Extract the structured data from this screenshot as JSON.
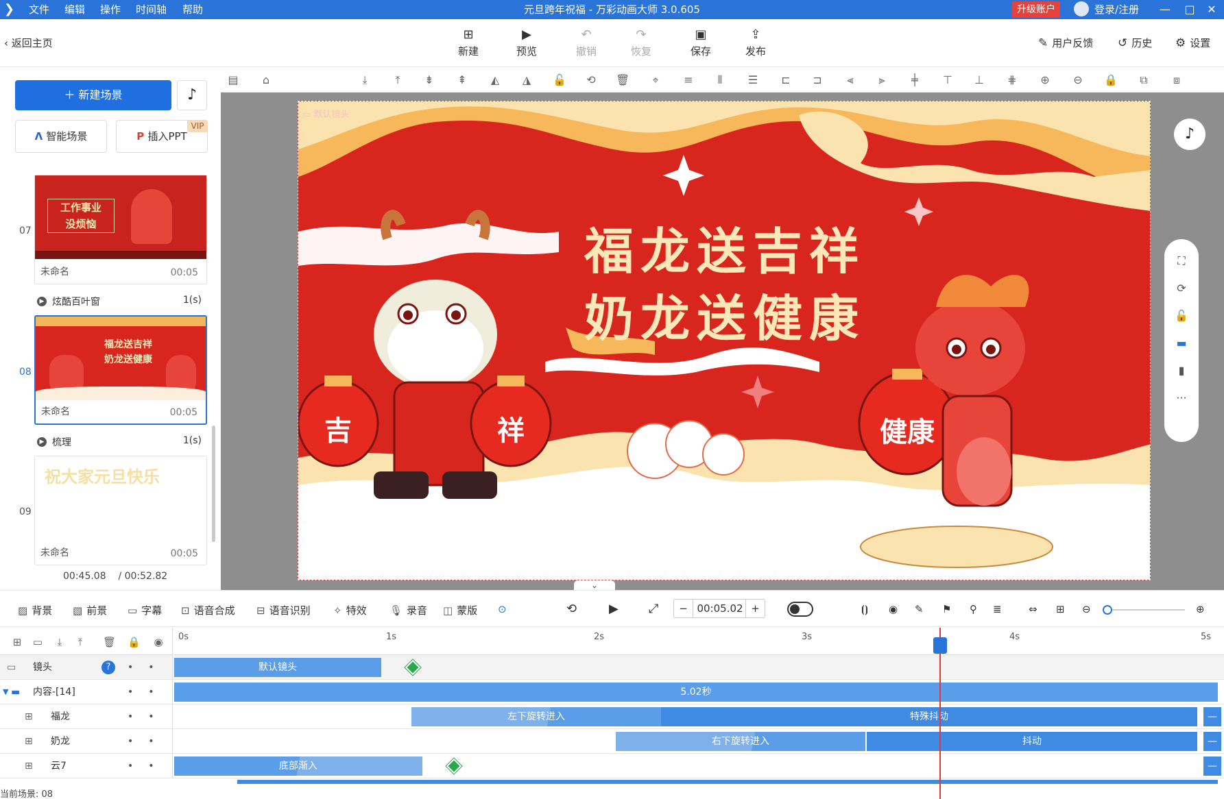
{
  "window": {
    "menu": [
      "文件",
      "编辑",
      "操作",
      "时间轴",
      "帮助"
    ],
    "title": "元旦跨年祝福 - 万彩动画大师 3.0.605",
    "upgrade": "升级账户",
    "login": "登录/注册",
    "controls": [
      "—",
      "□",
      "✕"
    ]
  },
  "topbar": {
    "back": "返回主页",
    "tools": [
      {
        "label": "新建",
        "icon": "plus-square-icon"
      },
      {
        "label": "预览",
        "icon": "play-icon"
      },
      {
        "label": "撤销",
        "icon": "undo-icon"
      },
      {
        "label": "恢复",
        "icon": "redo-icon"
      },
      {
        "label": "保存",
        "icon": "save-icon"
      },
      {
        "label": "发布",
        "icon": "publish-icon"
      }
    ],
    "right": [
      "用户反馈",
      "历史",
      "设置"
    ]
  },
  "left": {
    "new_scene": "新建场景",
    "smart_scene": "智能场景",
    "insert_ppt": "插入PPT",
    "vip": "VIP",
    "scenes": [
      {
        "num": "07",
        "name": "未命名",
        "dur": "00:05",
        "thumb_text": [
          "工作事业",
          "没烦恼"
        ]
      },
      {
        "num": "08",
        "name": "未命名",
        "dur": "00:05",
        "thumb_text": [
          "福龙送吉祥",
          "奶龙送健康"
        ]
      },
      {
        "num": "09",
        "name": "未命名",
        "dur": "00:05",
        "thumb_text": [
          "祝大家元旦快乐"
        ]
      }
    ],
    "transitions": [
      {
        "name": "炫酷百叶窗",
        "dur": "1(s)"
      },
      {
        "name": "梳理",
        "dur": "1(s)"
      }
    ],
    "time_current": "00:45.08",
    "time_total": "/ 00:52.82"
  },
  "canvas": {
    "camera_label": "默认镜头",
    "line1": "福龙送吉祥",
    "line2": "奶龙送健康",
    "lantern1": "吉",
    "lantern2": "祥",
    "lantern3": "健康"
  },
  "bottombar": {
    "items": [
      "背景",
      "前景",
      "字幕",
      "语音合成",
      "语音识别",
      "特效",
      "录音",
      "蒙版"
    ],
    "time": "00:05.02",
    "minus": "−",
    "plus": "+"
  },
  "timeline": {
    "ticks": [
      "0s",
      "1s",
      "2s",
      "3s",
      "4s",
      "5s"
    ],
    "tracks": [
      {
        "name": "镜头",
        "bars": [
          {
            "label": "默认镜头"
          }
        ]
      },
      {
        "name": "内容-[14]",
        "bars": [
          {
            "label": "5.02秒"
          }
        ]
      },
      {
        "name": "福龙",
        "bars": [
          {
            "label": "左下旋转进入"
          },
          {
            "label": "特殊抖动"
          }
        ]
      },
      {
        "name": "奶龙",
        "bars": [
          {
            "label": "右下旋转进入"
          },
          {
            "label": "抖动"
          }
        ]
      },
      {
        "name": "云7",
        "bars": [
          {
            "label": "底部渐入"
          }
        ]
      }
    ],
    "current_scene": "当前场景: 08"
  }
}
